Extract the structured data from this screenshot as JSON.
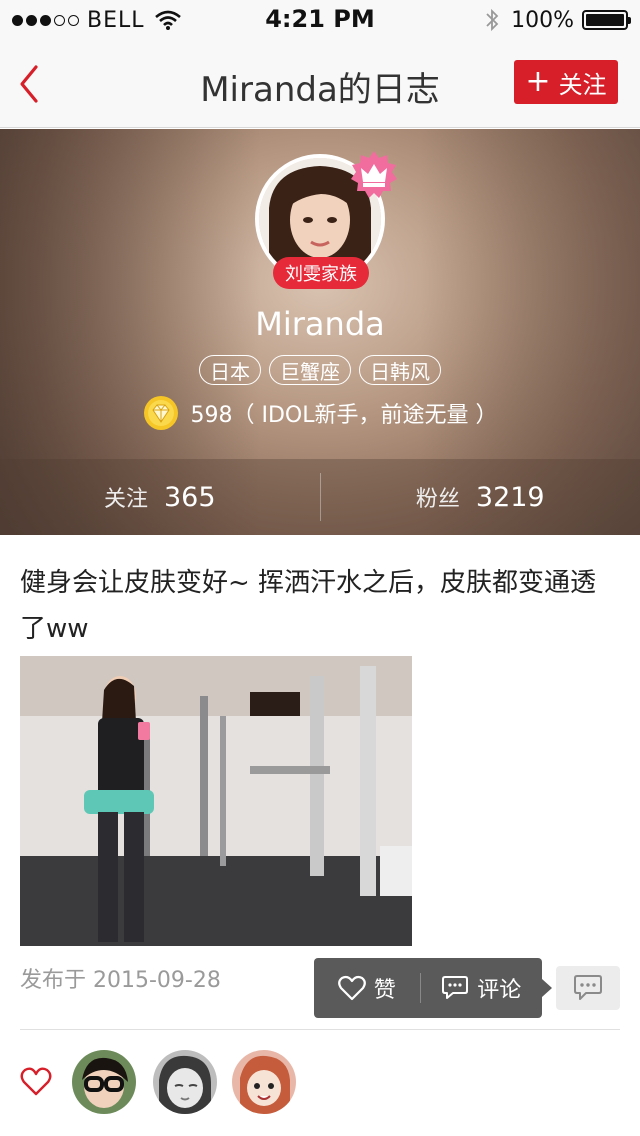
{
  "status_bar": {
    "carrier": "BELL",
    "time": "4:21 PM",
    "battery": "100%"
  },
  "nav": {
    "title": "Miranda的日志",
    "follow_plus": "+",
    "follow_label": "关注"
  },
  "profile": {
    "family_badge": "刘雯家族",
    "name": "Miranda",
    "tags": [
      "日本",
      "巨蟹座",
      "日韩风"
    ],
    "level_text": "598（ IDOL新手，前途无量 ）",
    "stats": {
      "following_label": "关注",
      "following_value": "365",
      "fans_label": "粉丝",
      "fans_value": "3219"
    }
  },
  "post": {
    "text": "健身会让皮肤变好~ 挥洒汗水之后，皮肤都变通透了ww",
    "date": "发布于 2015-09-28"
  },
  "actions": {
    "like_label": "赞",
    "comment_label": "评论"
  },
  "colors": {
    "accent": "#d71f2a",
    "badge": "#e62a3a",
    "popup": "#5a5a5a"
  },
  "icons": [
    "back-chevron-icon",
    "crown-icon",
    "diamond-icon",
    "heart-icon",
    "comment-bubble-icon",
    "wifi-icon",
    "bluetooth-icon",
    "battery-icon"
  ]
}
